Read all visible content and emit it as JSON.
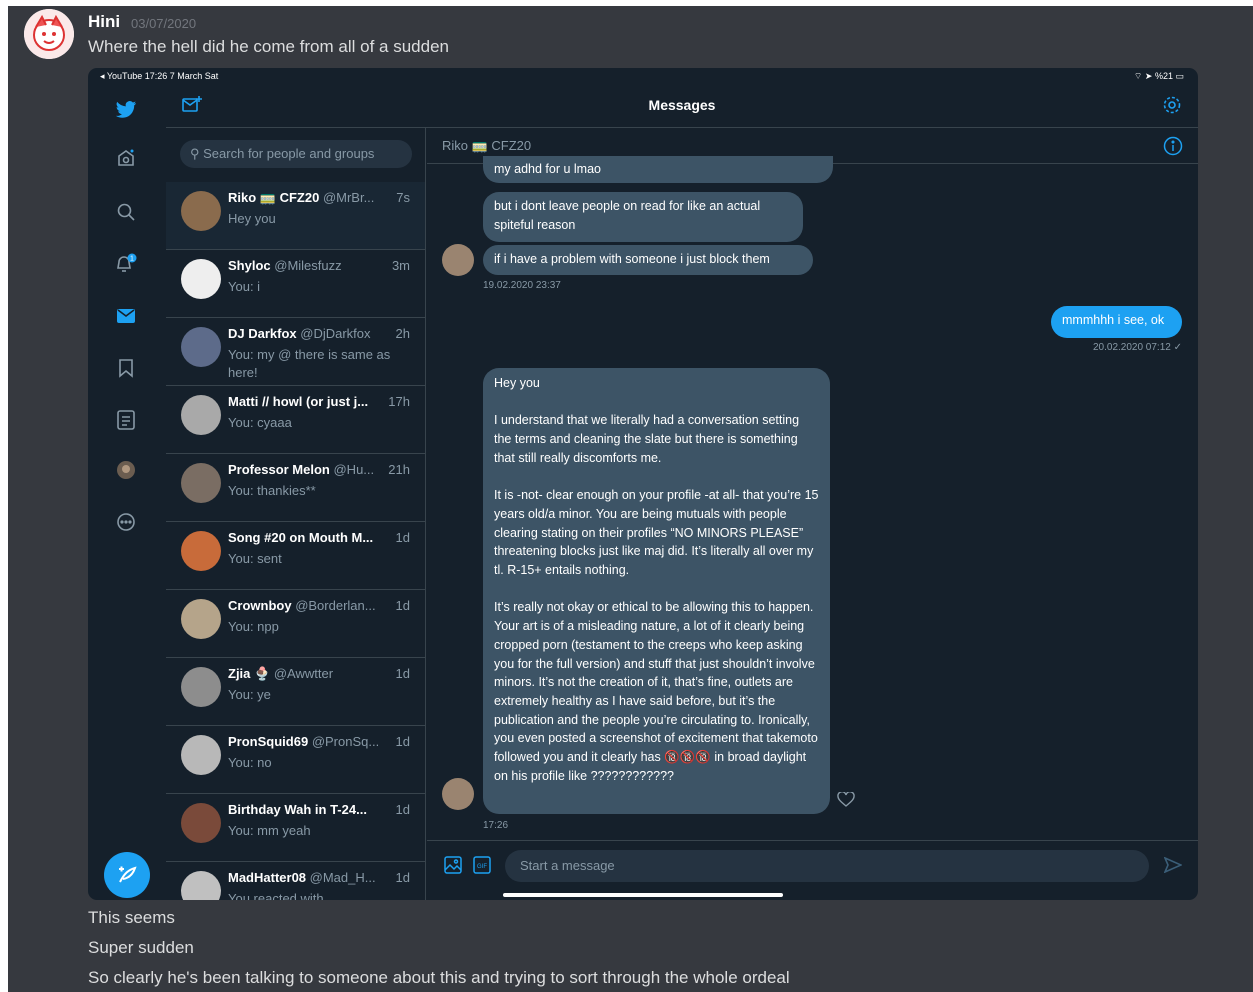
{
  "discord": {
    "username": "Hini",
    "date": "03/07/2020",
    "first_line": "Where the hell did he come from all of a sudden",
    "after_lines": [
      "This seems",
      "Super sudden",
      "So clearly he's been talking to someone about this and trying to sort through the whole ordeal"
    ]
  },
  "statusbar": {
    "left": "◂ YouTube  17:26  7 March Sat",
    "right": "%21"
  },
  "header": {
    "title": "Messages"
  },
  "search": {
    "placeholder": "Search for people and groups"
  },
  "conversations": [
    {
      "name": "Riko 🚃 CFZ20",
      "handle": "@MrBr...",
      "time": "7s",
      "preview": "Hey you"
    },
    {
      "name": "Shyloc",
      "handle": "@Milesfuzz",
      "time": "3m",
      "preview": "You: i"
    },
    {
      "name": "DJ Darkfox",
      "handle": "@DjDarkfox",
      "time": "2h",
      "preview": "You: my @ there is same as here!"
    },
    {
      "name": "Matti // howl (or just j...",
      "handle": "",
      "time": "17h",
      "preview": "You: cyaaa"
    },
    {
      "name": "Professor Melon",
      "handle": "@Hu...",
      "time": "21h",
      "preview": "You: thankies**"
    },
    {
      "name": "Song #20 on Mouth M...",
      "handle": "",
      "time": "1d",
      "preview": "You: sent"
    },
    {
      "name": "Crownboy",
      "handle": "@Borderlan...",
      "time": "1d",
      "preview": "You: npp"
    },
    {
      "name": "Zjia 🍨",
      "handle": "@Awwtter",
      "time": "1d",
      "preview": "You: ye"
    },
    {
      "name": "PronSquid69",
      "handle": "@PronSq...",
      "time": "1d",
      "preview": "You: no"
    },
    {
      "name": "Birthday Wah in T-24...",
      "handle": "",
      "time": "1d",
      "preview": "You: mm yeah"
    },
    {
      "name": "MadHatter08",
      "handle": "@Mad_H...",
      "time": "1d",
      "preview": "You reacted with"
    }
  ],
  "chat": {
    "title": "Riko 🚃 CFZ20",
    "b1": "my adhd for u lmao",
    "b2": "but i dont leave people on read for like an actual spiteful reason",
    "b3": "if i have a problem with someone i just block them",
    "ts1": "19.02.2020 23:37",
    "b4": "mmmhhh i see, ok",
    "ts2": "20.02.2020 07:12 ✓",
    "long": "Hey you\n\nI understand that we literally had a conversation setting the terms and cleaning the slate but there is something that still really discomforts me.\n\nIt is -not- clear enough on your profile -at all- that you’re 15 years old/a minor. You are being mutuals with people clearing stating on their profiles “NO MINORS PLEASE” threatening blocks just like maj did. It’s literally all over my tl. R-15+ entails nothing.\n\nIt’s really not okay or ethical to be allowing this to happen. Your art is of a misleading nature, a lot of it clearly being cropped porn (testament to the creeps who keep asking you for the full version) and stuff that just shouldn’t involve minors. It’s not the creation of it, that’s fine, outlets are extremely healthy as I have said before, but it’s the publication and the people you’re circulating to. Ironically, you even posted a screenshot of excitement that takemoto followed you and it clearly has 🔞🔞🔞 in broad daylight on his profile like ????????????",
    "ts3": "17:26"
  },
  "composer": {
    "placeholder": "Start a message"
  },
  "colors": {
    "accent": "#1da1f2",
    "bg": "#15202b"
  }
}
